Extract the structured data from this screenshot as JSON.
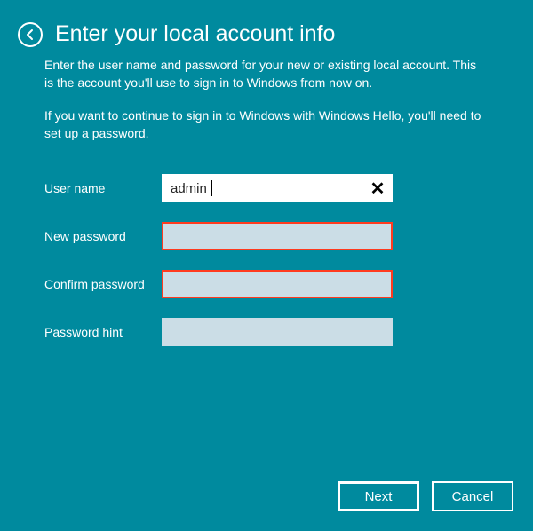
{
  "header": {
    "title": "Enter your local account info"
  },
  "intro": {
    "p1": "Enter the user name and password for your new or existing local account. This is the account you'll use to sign in to Windows from now on.",
    "p2": "If you want to continue to sign in to Windows with Windows Hello, you'll need to set up a password."
  },
  "form": {
    "username_label": "User name",
    "username_value": "admin",
    "newpassword_label": "New password",
    "newpassword_value": "",
    "confirmpassword_label": "Confirm password",
    "confirmpassword_value": "",
    "hint_label": "Password hint",
    "hint_value": "",
    "clear_symbol": "✕"
  },
  "buttons": {
    "next": "Next",
    "cancel": "Cancel"
  },
  "icons": {
    "back": "back-arrow"
  },
  "colors": {
    "background": "#008a9e",
    "error_border": "#ff3b1f",
    "dim_field": "#cbdde6"
  }
}
